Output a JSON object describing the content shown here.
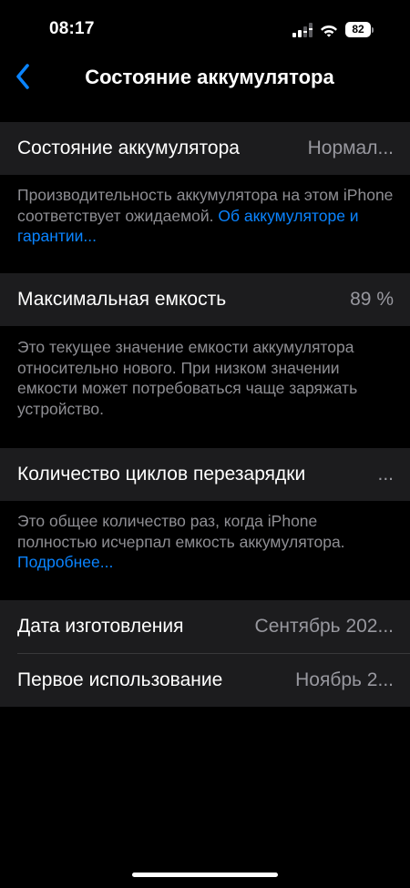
{
  "status_bar": {
    "time": "08:17",
    "battery_level": "82",
    "icons": [
      "signal-icon",
      "wifi-icon",
      "battery-icon"
    ]
  },
  "nav": {
    "title": "Состояние аккумулятора",
    "back_icon": "chevron-left-icon"
  },
  "battery_health": {
    "label": "Состояние аккумулятора",
    "value": "Нормал...",
    "footnote": "Производительность аккумулятора на этом iPhone соответствует ожидаемой.",
    "link": "Об аккумуляторе и гарантии..."
  },
  "max_capacity": {
    "label": "Максимальная емкость",
    "value": "89 %",
    "footnote": "Это текущее значение емкости аккумулятора относительно нового. При низком значении емкости может потребоваться чаще заряжать устройство."
  },
  "cycle_count": {
    "label": "Количество циклов перезарядки",
    "value": "...",
    "footnote": "Это общее количество раз, когда iPhone полностью исчерпал емкость аккумулятора.",
    "link": "Подробнее..."
  },
  "dates": {
    "manufacture_label": "Дата изготовления",
    "manufacture_value": "Сентябрь 202...",
    "first_use_label": "Первое использование",
    "first_use_value": "Ноябрь 2..."
  },
  "colors": {
    "background": "#000000",
    "cell": "#1c1c1e",
    "accent": "#0a84ff",
    "secondary_text": "#8e8e93"
  }
}
